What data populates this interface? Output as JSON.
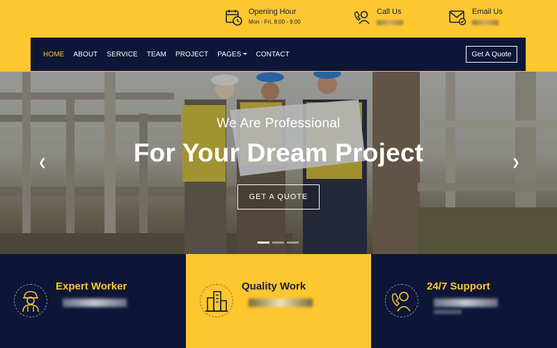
{
  "topbar": {
    "opening": {
      "title": "Opening Hour",
      "value": "Mon - Fri, 8:00 - 9:00",
      "icon": "clock-calendar-icon"
    },
    "call": {
      "title": "Call Us",
      "icon": "phone-support-icon"
    },
    "email": {
      "title": "Email Us",
      "icon": "email-icon"
    }
  },
  "nav": {
    "items": [
      "HOME",
      "ABOUT",
      "SERVICE",
      "TEAM",
      "PROJECT",
      "PAGES",
      "CONTACT"
    ],
    "active": "HOME",
    "quote_label": "Get A Quote"
  },
  "hero": {
    "subtitle": "We Are Professional",
    "title": "For Your Dream Project",
    "cta_label": "GET A QUOTE",
    "prev_icon": "chevron-left-icon",
    "next_icon": "chevron-right-icon",
    "slides": 3,
    "active_slide": 1
  },
  "features": [
    {
      "title": "Expert Worker",
      "icon": "worker-icon"
    },
    {
      "title": "Quality Work",
      "icon": "buildings-icon"
    },
    {
      "title": "24/7 Support",
      "icon": "support-agent-icon"
    }
  ],
  "colors": {
    "accent": "#fec62f",
    "navy": "#0d1636",
    "white": "#ffffff"
  }
}
